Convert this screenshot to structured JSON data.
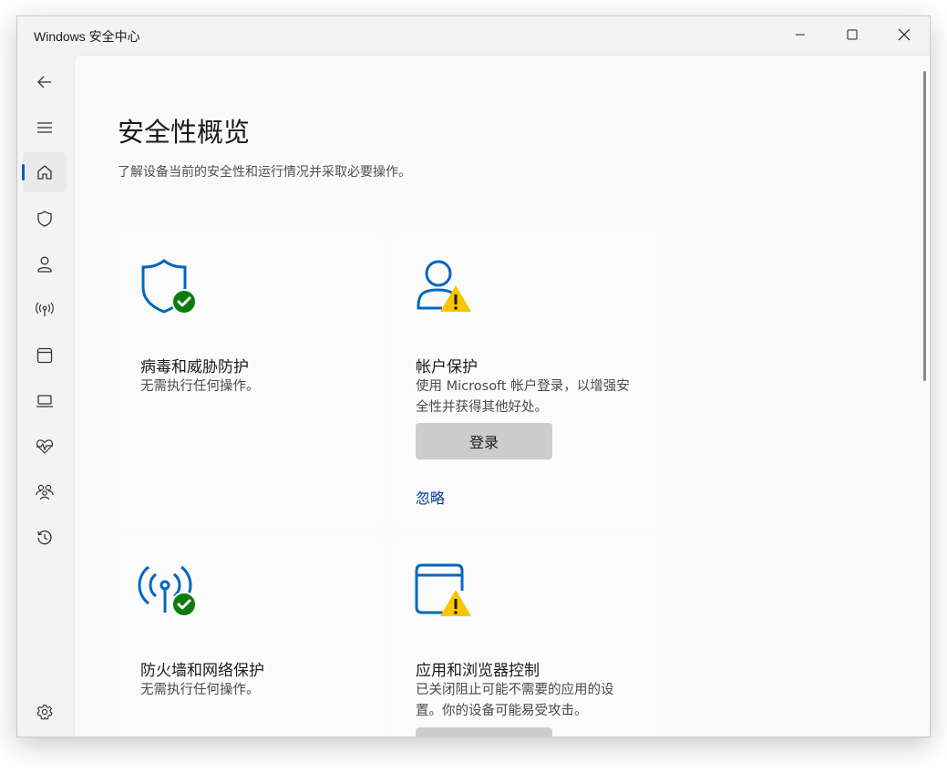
{
  "window": {
    "title": "Windows 安全中心"
  },
  "page": {
    "title": "安全性概览",
    "subtitle": "了解设备当前的安全性和运行情况并采取必要操作。"
  },
  "sidebar": {
    "items": [
      {
        "icon": "back-arrow-icon"
      },
      {
        "icon": "hamburger-menu-icon"
      },
      {
        "icon": "home-icon",
        "active": true
      },
      {
        "icon": "shield-icon"
      },
      {
        "icon": "person-icon"
      },
      {
        "icon": "wireless-antenna-icon"
      },
      {
        "icon": "app-browser-window-icon"
      },
      {
        "icon": "laptop-icon"
      },
      {
        "icon": "heart-pulse-icon"
      },
      {
        "icon": "family-icon"
      },
      {
        "icon": "history-icon"
      },
      {
        "icon": "gear-icon"
      }
    ]
  },
  "cards": [
    {
      "title": "病毒和威胁防护",
      "desc": "无需执行任何操作。",
      "status": "ok"
    },
    {
      "title": "帐户保护",
      "desc": "使用 Microsoft 帐户登录，以增强安全性并获得其他好处。",
      "status": "warning",
      "button": "登录",
      "link": "忽略"
    },
    {
      "title": "防火墙和网络保护",
      "desc": "无需执行任何操作。",
      "status": "ok"
    },
    {
      "title": "应用和浏览器控制",
      "desc": "已关闭阻止可能不需要的应用的设置。你的设备可能易受攻击。",
      "status": "warning"
    }
  ],
  "colors": {
    "accent": "#005fb8",
    "icon_blue": "#0067c0",
    "ok_green": "#0f7b0f",
    "warning_yellow": "#f7c600"
  }
}
